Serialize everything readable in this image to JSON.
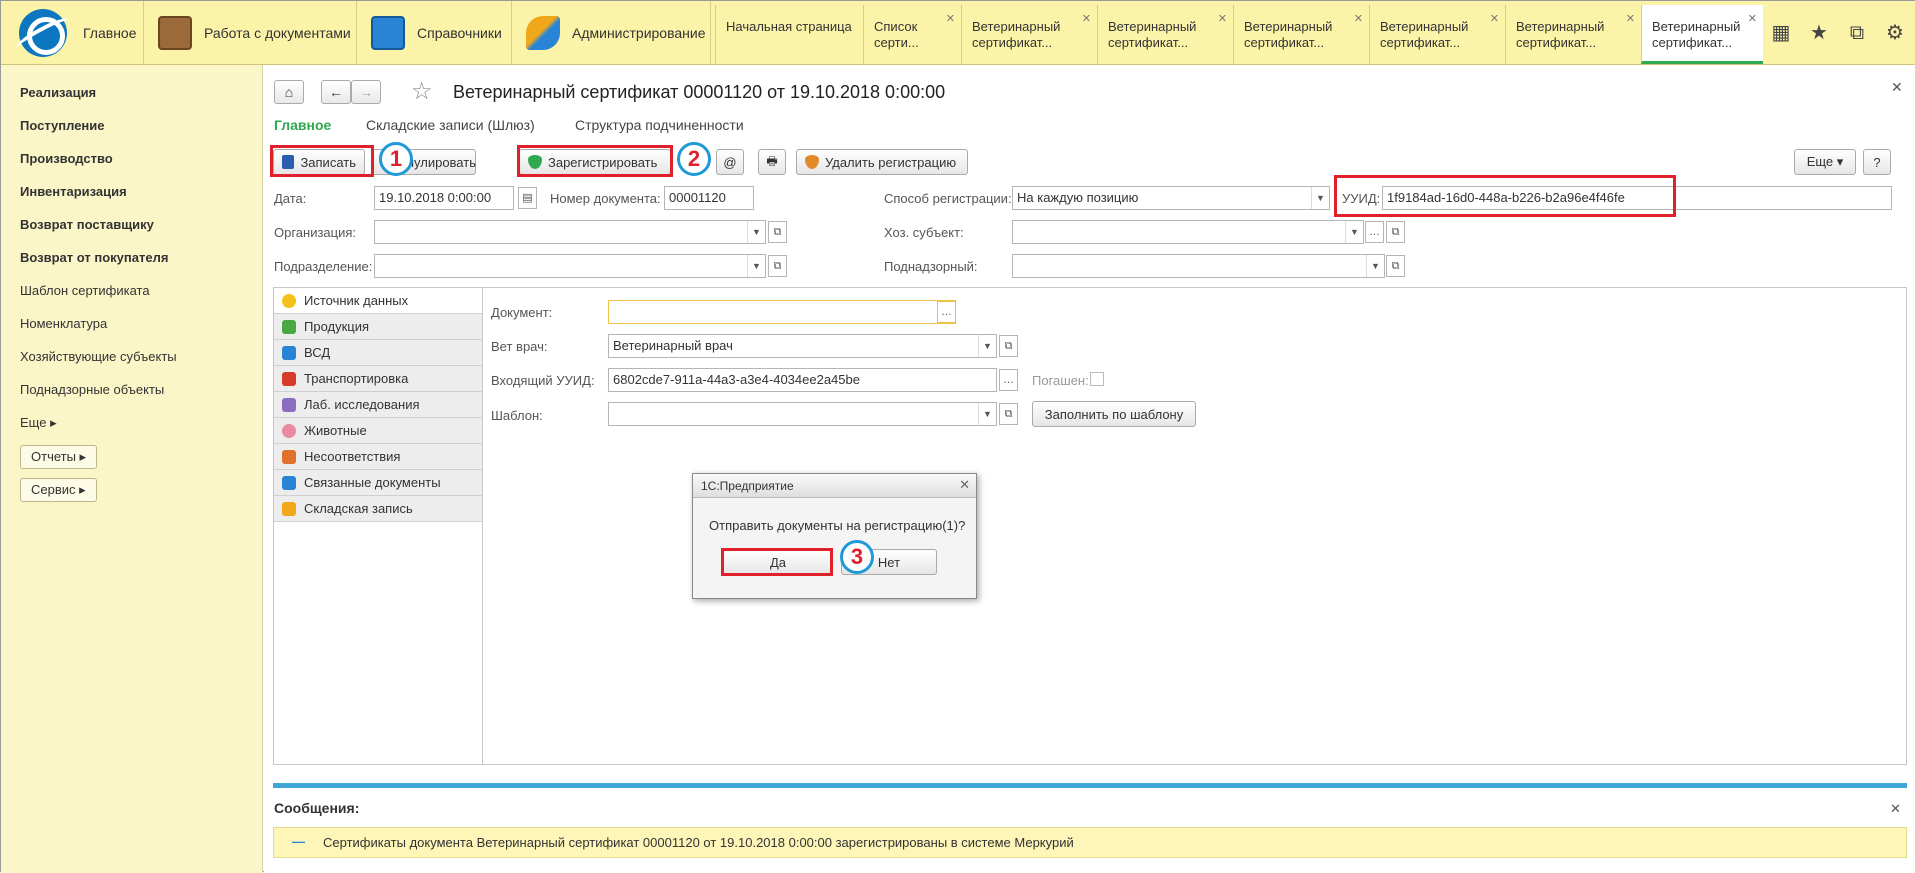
{
  "topbar": {
    "sections": [
      {
        "label": "Главное",
        "icon": "1c-logo-icon"
      },
      {
        "label": "Работа с документами",
        "icon": "briefcase-icon"
      },
      {
        "label": "Справочники",
        "icon": "phonebook-icon"
      },
      {
        "label": "Администрирование",
        "icon": "tools-icon"
      }
    ],
    "tabs": [
      {
        "label": "Начальная страница"
      },
      {
        "label": "Список серти..."
      },
      {
        "label": "Ветеринарный сертификат..."
      },
      {
        "label": "Ветеринарный сертификат..."
      },
      {
        "label": "Ветеринарный сертификат..."
      },
      {
        "label": "Ветеринарный сертификат..."
      },
      {
        "label": "Ветеринарный сертификат..."
      },
      {
        "label": "Ветеринарный сертификат..."
      }
    ],
    "buttons": [
      "grid-icon",
      "star-icon",
      "history-icon",
      "gear-icon"
    ]
  },
  "sidebar": {
    "items": [
      {
        "label": "Реализация",
        "bold": true
      },
      {
        "label": "Поступление",
        "bold": true
      },
      {
        "label": "Производство",
        "bold": true
      },
      {
        "label": "Инвентаризация",
        "bold": true
      },
      {
        "label": "Возврат поставщику",
        "bold": true
      },
      {
        "label": "Возврат от покупателя",
        "bold": true
      },
      {
        "label": "Шаблон сертификата",
        "bold": false
      },
      {
        "label": "Номенклатура",
        "bold": false
      },
      {
        "label": "Хозяйствующие субъекты",
        "bold": false
      },
      {
        "label": "Поднадзорные объекты",
        "bold": false
      },
      {
        "label": "Еще ▸",
        "bold": false
      }
    ],
    "buttons": [
      {
        "label": "Отчеты ▸"
      },
      {
        "label": "Сервис ▸"
      }
    ]
  },
  "doc": {
    "title": "Ветеринарный сертификат 00001120 от 19.10.2018 0:00:00",
    "subtabs": [
      "Главное",
      "Складские записи (Шлюз)",
      "Структура подчиненности"
    ],
    "toolbar": {
      "save": "Записать",
      "annul": "Аннулировать",
      "register": "Зарегистрировать",
      "email": "@",
      "delete_reg": "Удалить регистрацию",
      "more": "Еще ▾",
      "help": "?"
    },
    "fields": {
      "date_label": "Дата:",
      "date_value": "19.10.2018  0:00:00",
      "number_label": "Номер документа:",
      "number_value": "00001120",
      "regmode_label": "Способ регистрации:",
      "regmode_value": "На каждую позицию",
      "uuid_label": "УУИД:",
      "uuid_value": "1f9184ad-16d0-448a-b226-b2a96e4f46fe",
      "org_label": "Организация:",
      "org_value": "",
      "subject_label": "Хоз. субъект:",
      "subject_value": "",
      "dept_label": "Подразделение:",
      "dept_value": "",
      "supervised_label": "Поднадзорный:",
      "supervised_value": ""
    },
    "pages": [
      {
        "label": "Источник данных",
        "color": "#f2c21b"
      },
      {
        "label": "Продукция",
        "color": "#4aa844"
      },
      {
        "label": "ВСД",
        "color": "#2a84d6"
      },
      {
        "label": "Транспортировка",
        "color": "#d43b2a"
      },
      {
        "label": "Лаб. исследования",
        "color": "#8a6cc0"
      },
      {
        "label": "Животные",
        "color": "#e88aa0"
      },
      {
        "label": "Несоответствия",
        "color": "#e0702a"
      },
      {
        "label": "Связанные документы",
        "color": "#2a84d6"
      },
      {
        "label": "Складская запись",
        "color": "#f0a81a"
      }
    ],
    "source": {
      "document_label": "Документ:",
      "document_value": "",
      "vet_label": "Вет врач:",
      "vet_value": "Ветеринарный врач",
      "incoming_uuid_label": "Входящий УУИД:",
      "incoming_uuid_value": "6802cde7-911a-44a3-a3e4-4034ee2a45be",
      "repaid_label": "Погашен:",
      "template_label": "Шаблон:",
      "template_value": "",
      "fill_button": "Заполнить по шаблону"
    }
  },
  "dialog": {
    "title": "1С:Предприятие",
    "message": "Отправить документы на регистрацию(1)?",
    "yes": "Да",
    "no": "Нет"
  },
  "messages": {
    "title": "Сообщения:",
    "text": "Сертификаты документа Ветеринарный сертификат 00001120 от 19.10.2018 0:00:00  зарегистрированы в системе Меркурий"
  },
  "badges": [
    "1",
    "2",
    "3"
  ],
  "colors": {
    "highlight_red": "#e0202a",
    "badge_blue": "#1f9ad6",
    "accent_green": "#2fa84f",
    "topbar_bg": "#fbf3a8",
    "message_bg": "#fdf6b8"
  }
}
